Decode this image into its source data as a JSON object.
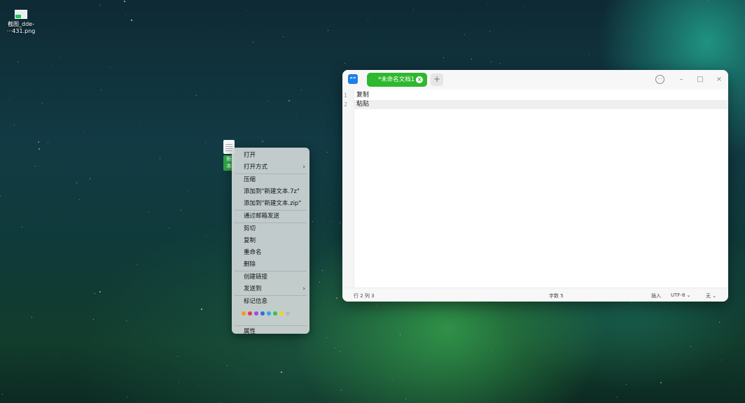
{
  "desktop": {
    "icons": [
      {
        "label_line1": "截图_dde-",
        "label_line2": "···431.png"
      },
      {
        "label_line1": "新",
        "label_line2": "本"
      }
    ]
  },
  "context_menu": {
    "items": [
      {
        "label": "打开"
      },
      {
        "label": "打开方式",
        "arrow": "›"
      },
      {
        "label": "压缩"
      },
      {
        "label": "添加到\"新建文本.7z\""
      },
      {
        "label": "添加到\"新建文本.zip\""
      },
      {
        "label": "通过邮箱发送"
      },
      {
        "label": "剪切"
      },
      {
        "label": "复制"
      },
      {
        "label": "重命名"
      },
      {
        "label": "删除"
      },
      {
        "label": "创建链接"
      },
      {
        "label": "发送到",
        "arrow": "›"
      },
      {
        "label": "标记信息"
      },
      {
        "label": "属性"
      }
    ],
    "tag_colors": [
      "#f39a1b",
      "#e8364b",
      "#a349d8",
      "#3866e6",
      "#2aa9e6",
      "#32c05a",
      "#f5d31c",
      "#b8b8b8"
    ]
  },
  "editor": {
    "app_icon_text": "“”",
    "tab": {
      "label": "*未命名文档1",
      "close_symbol": "×"
    },
    "add_tab_symbol": "+",
    "window_controls": {
      "menu": "···",
      "minimize": "–",
      "maximize": "□",
      "close": "×"
    },
    "line_numbers": [
      "1",
      "2"
    ],
    "lines": [
      "复制",
      "粘贴"
    ],
    "status": {
      "position": "行 2 列 3",
      "char_count": "字数 5",
      "insert_mode": "插入",
      "encoding": "UTF-8",
      "encoding_arrow": "⌄",
      "highlight": "无",
      "highlight_arrow": "⌄"
    }
  }
}
